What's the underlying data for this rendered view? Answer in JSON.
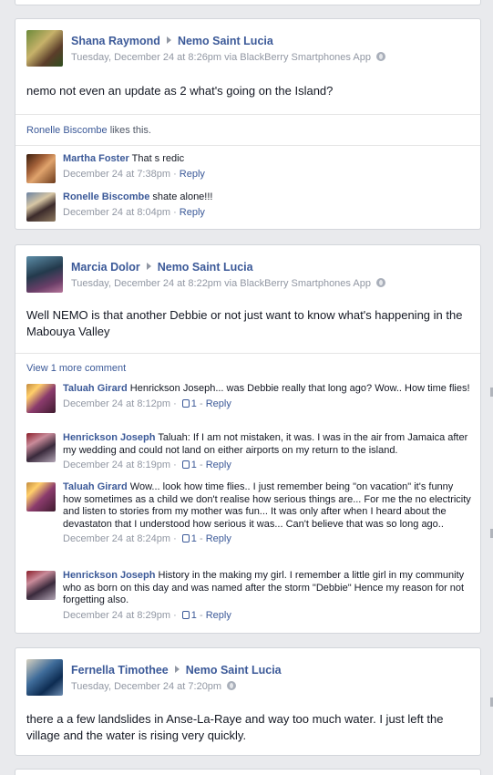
{
  "posts": [
    {
      "author": "Shana Raymond",
      "target": "Nemo Saint Lucia",
      "meta": "Tuesday, December 24 at 8:26pm via BlackBerry Smartphones App",
      "body": "nemo not even an update as 2 what's going on the Island?",
      "likes": {
        "name": "Ronelle Biscombe",
        "suffix": " likes this."
      },
      "comments": [
        {
          "name": "Martha Foster",
          "text": "That s redic",
          "time": "December 24 at 7:38pm",
          "likes": "",
          "reply": "Reply"
        },
        {
          "name": "Ronelle Biscombe",
          "text": "shate alone!!!",
          "time": "December 24 at 8:04pm",
          "likes": "",
          "reply": "Reply"
        }
      ]
    },
    {
      "author": "Marcia Dolor",
      "target": "Nemo Saint Lucia",
      "meta": "Tuesday, December 24 at 8:22pm via BlackBerry Smartphones App",
      "body": "Well NEMO is that another Debbie or not just want to know what's happening in the Mabouya Valley",
      "view_more": "View 1 more comment",
      "comments": [
        {
          "name": "Taluah Girard",
          "text": "Henrickson Joseph... was Debbie really that long ago? Wow.. How time flies!",
          "time": "December 24 at 8:12pm",
          "likes": "1",
          "reply": "Reply"
        },
        {
          "name": "Henrickson Joseph",
          "text": "Taluah: If I am not mistaken, it was. I was in the air from Jamaica after my wedding and could not land on either airports on my return to the island.",
          "time": "December 24 at 8:19pm",
          "likes": "1",
          "reply": "Reply"
        },
        {
          "name": "Taluah Girard",
          "text": "Wow... look how time flies.. I just remember being \"on vacation\" it's funny how sometimes as a child we don't realise how serious things are... For me the no electricity and listen to stories from my mother was fun... It was only after when I heard about the devastaton that I understood how serious it was... Can't believe that was so long ago..",
          "time": "December 24 at 8:24pm",
          "likes": "1",
          "reply": "Reply"
        },
        {
          "name": "Henrickson Joseph",
          "text": "History in the making my girl. I remember a little girl in my community who as born on this day and was named after the storm \"Debbie\" Hence my reason for not forgetting also.",
          "time": "December 24 at 8:29pm",
          "likes": "1",
          "reply": "Reply"
        }
      ]
    },
    {
      "author": "Fernella Timothee",
      "target": "Nemo Saint Lucia",
      "meta": "Tuesday, December 24 at 7:20pm",
      "body": "there a a few landslides in Anse-La-Raye and way too much water. I just left the village and the water is rising very quickly."
    }
  ]
}
